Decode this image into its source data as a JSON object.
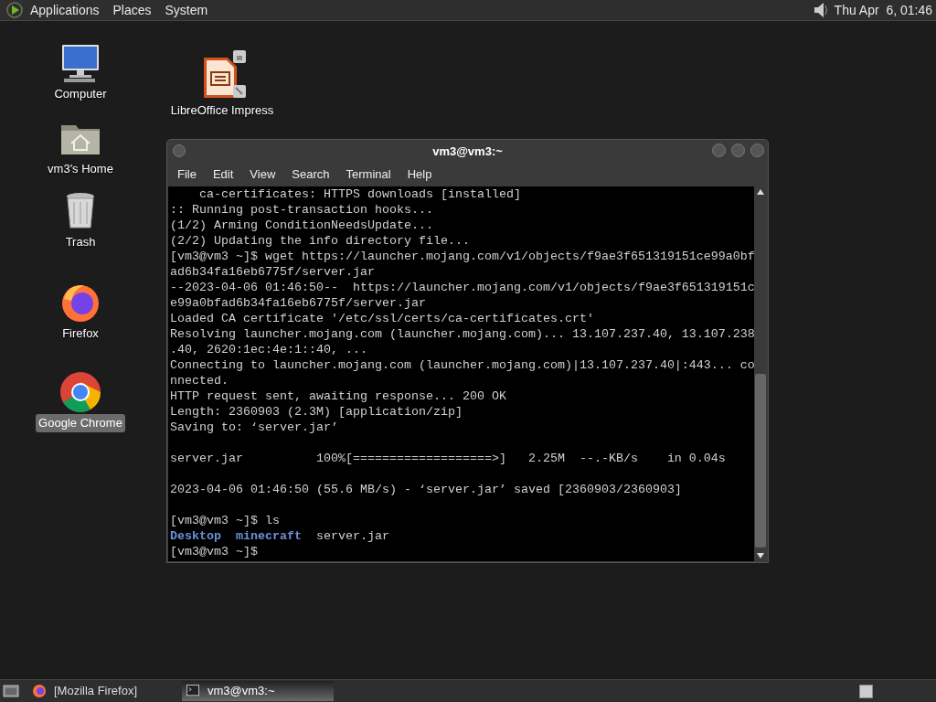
{
  "top_panel": {
    "menus": [
      "Applications",
      "Places",
      "System"
    ],
    "clock": "Thu Apr  6, 01:46"
  },
  "desktop_icons": [
    {
      "label": "Computer",
      "kind": "computer",
      "selected": false
    },
    {
      "label": "vm3's Home",
      "kind": "home",
      "selected": false
    },
    {
      "label": "Trash",
      "kind": "trash",
      "selected": false
    },
    {
      "label": "Firefox",
      "kind": "firefox",
      "selected": false
    },
    {
      "label": "Google Chrome",
      "kind": "chrome",
      "selected": true
    },
    {
      "label": "LibreOffice Impress",
      "kind": "impress",
      "selected": false
    }
  ],
  "window": {
    "title": "vm3@vm3:~",
    "menus": [
      "File",
      "Edit",
      "View",
      "Search",
      "Terminal",
      "Help"
    ],
    "lines": [
      {
        "kind": "text",
        "text": "    ca-certificates: HTTPS downloads [installed]"
      },
      {
        "kind": "text",
        "text": ":: Running post-transaction hooks..."
      },
      {
        "kind": "text",
        "text": "(1/2) Arming ConditionNeedsUpdate..."
      },
      {
        "kind": "text",
        "text": "(2/2) Updating the info directory file..."
      },
      {
        "kind": "text",
        "text": "[vm3@vm3 ~]$ wget https://launcher.mojang.com/v1/objects/f9ae3f651319151ce99a0bf"
      },
      {
        "kind": "text",
        "text": "ad6b34fa16eb6775f/server.jar"
      },
      {
        "kind": "text",
        "text": "--2023-04-06 01:46:50--  https://launcher.mojang.com/v1/objects/f9ae3f651319151c"
      },
      {
        "kind": "text",
        "text": "e99a0bfad6b34fa16eb6775f/server.jar"
      },
      {
        "kind": "text",
        "text": "Loaded CA certificate '/etc/ssl/certs/ca-certificates.crt'"
      },
      {
        "kind": "text",
        "text": "Resolving launcher.mojang.com (launcher.mojang.com)... 13.107.237.40, 13.107.238"
      },
      {
        "kind": "text",
        "text": ".40, 2620:1ec:4e:1::40, ..."
      },
      {
        "kind": "text",
        "text": "Connecting to launcher.mojang.com (launcher.mojang.com)|13.107.237.40|:443... co"
      },
      {
        "kind": "text",
        "text": "nnected."
      },
      {
        "kind": "text",
        "text": "HTTP request sent, awaiting response... 200 OK"
      },
      {
        "kind": "text",
        "text": "Length: 2360903 (2.3M) [application/zip]"
      },
      {
        "kind": "text",
        "text": "Saving to: ‘server.jar’"
      },
      {
        "kind": "blank"
      },
      {
        "kind": "text",
        "text": "server.jar          100%[===================>]   2.25M  --.-KB/s    in 0.04s"
      },
      {
        "kind": "blank"
      },
      {
        "kind": "text",
        "text": "2023-04-06 01:46:50 (55.6 MB/s) - ‘server.jar’ saved [2360903/2360903]"
      },
      {
        "kind": "blank"
      },
      {
        "kind": "text",
        "text": "[vm3@vm3 ~]$ ls"
      },
      {
        "kind": "listing",
        "entries": [
          {
            "name": "Desktop",
            "kind": "dir"
          },
          {
            "name": "minecraft",
            "kind": "dir"
          },
          {
            "name": "server.jar",
            "kind": "file"
          }
        ]
      },
      {
        "kind": "text",
        "text": "[vm3@vm3 ~]$"
      }
    ]
  },
  "taskbar": {
    "tasks": [
      {
        "label": "[Mozilla Firefox]",
        "kind": "firefox",
        "selected": false
      },
      {
        "label": "vm3@vm3:~",
        "kind": "terminal",
        "selected": true
      }
    ]
  }
}
